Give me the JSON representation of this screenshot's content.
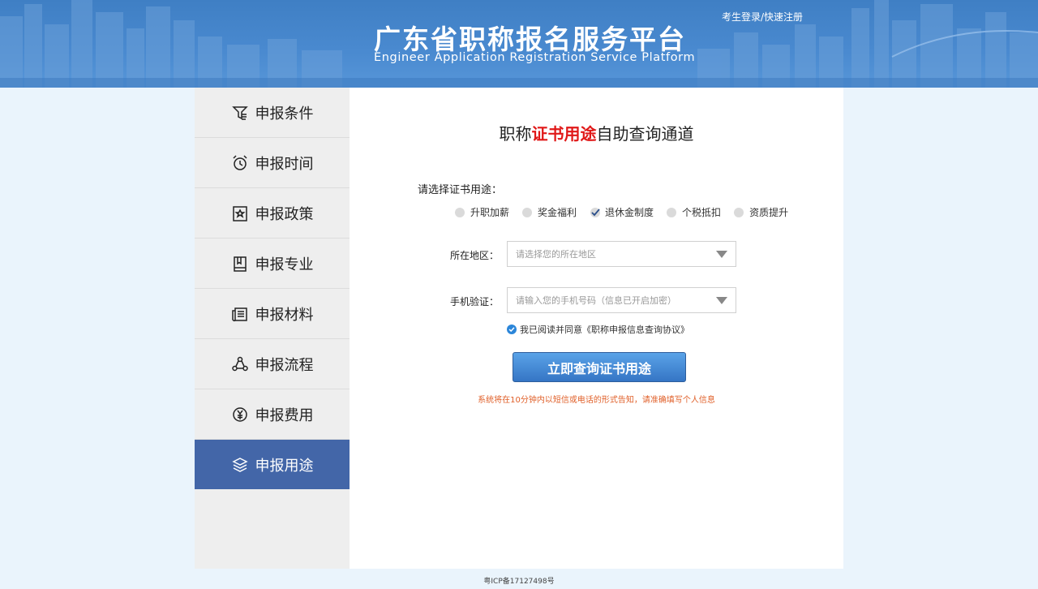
{
  "header": {
    "title": "广东省职称报名服务平台",
    "subtitle": "Engineer Application Registration Service Platform",
    "login_link": "考生登录/快速注册"
  },
  "sidebar": {
    "items": [
      {
        "label": "申报条件",
        "icon": "filter-list-icon"
      },
      {
        "label": "申报时间",
        "icon": "alarm-clock-icon"
      },
      {
        "label": "申报政策",
        "icon": "policy-document-icon"
      },
      {
        "label": "申报专业",
        "icon": "book-icon"
      },
      {
        "label": "申报材料",
        "icon": "newspaper-icon"
      },
      {
        "label": "申报流程",
        "icon": "process-cycle-icon"
      },
      {
        "label": "申报费用",
        "icon": "yen-coin-icon"
      },
      {
        "label": "申报用途",
        "icon": "layers-icon",
        "active": true
      }
    ]
  },
  "main": {
    "title_prefix": "职称",
    "title_highlight": "证书用途",
    "title_suffix": "自助查询通道",
    "purpose_label": "请选择证书用途：",
    "purpose_options": [
      {
        "label": "升职加薪",
        "checked": false
      },
      {
        "label": "奖金福利",
        "checked": false
      },
      {
        "label": "退休金制度",
        "checked": true
      },
      {
        "label": "个税抵扣",
        "checked": false
      },
      {
        "label": "资质提升",
        "checked": false
      }
    ],
    "region_label": "所在地区：",
    "region_placeholder": "请选择您的所在地区",
    "phone_label": "手机验证：",
    "phone_placeholder": "请输入您的手机号码（信息已开启加密）",
    "agree_text": "我已阅读并同意《职称申报信息查询协议》",
    "agree_checked": true,
    "submit_label": "立即查询证书用途",
    "notice": "系统将在10分钟内以短信或电话的形式告知，请准确填写个人信息"
  },
  "footer": {
    "icp": "粤ICP备17127498号"
  },
  "colors": {
    "header_blue": "#4a8ad0",
    "sidebar_active": "#4366a8",
    "highlight_red": "#e01818",
    "button_blue": "#3f85d3",
    "notice_orange": "#e0602a",
    "check_blue": "#2b86d9"
  }
}
